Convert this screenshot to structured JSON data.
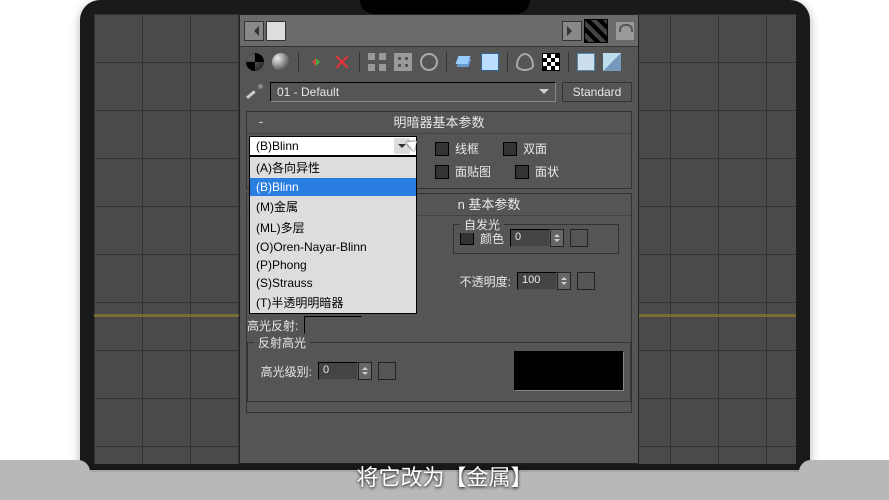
{
  "caption": "将它改为【金属】",
  "material": {
    "name": "01 - Default",
    "type_button": "Standard"
  },
  "rollouts": {
    "shader": {
      "title": "明暗器基本参数",
      "selected": "(B)Blinn",
      "checks": {
        "wire": "线框",
        "two_sided": "双面",
        "face_map": "面贴图",
        "faceted": "面状"
      },
      "options": [
        "(A)各向异性",
        "(B)Blinn",
        "(M)金属",
        "(ML)多层",
        "(O)Oren-Nayar-Blinn",
        "(P)Phong",
        "(S)Strauss",
        "(T)半透明明暗器"
      ],
      "highlight_index": 1
    },
    "blinn": {
      "title_suffix": "n 基本参数",
      "labels": {
        "self_illum_group": "自发光",
        "color": "颜色",
        "opacity": "不透明度:",
        "spec_reflect": "高光反射:",
        "spec_highlight_group": "反射高光",
        "spec_level": "高光级别:"
      },
      "values": {
        "self_illum": "0",
        "opacity": "100",
        "spec_level": "0"
      }
    }
  }
}
